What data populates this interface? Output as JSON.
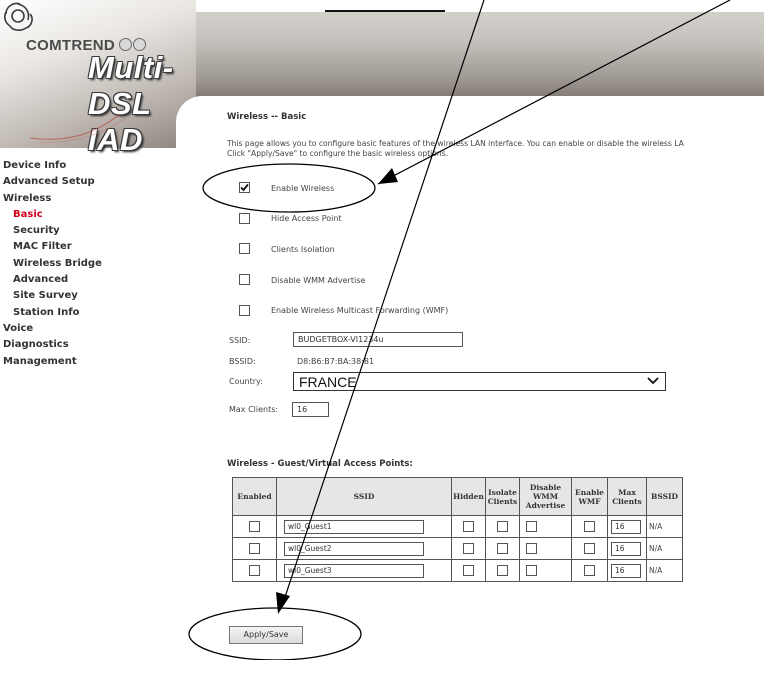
{
  "brand": {
    "company": "COMTREND",
    "product": "Multi-DSL IAD"
  },
  "sidebar": {
    "items": [
      {
        "label": "Device Info",
        "level": 0
      },
      {
        "label": "Advanced Setup",
        "level": 0
      },
      {
        "label": "Wireless",
        "level": 0
      },
      {
        "label": "Basic",
        "level": 1,
        "active": true
      },
      {
        "label": "Security",
        "level": 1
      },
      {
        "label": "MAC Filter",
        "level": 1
      },
      {
        "label": "Wireless Bridge",
        "level": 1
      },
      {
        "label": "Advanced",
        "level": 1
      },
      {
        "label": "Site Survey",
        "level": 1
      },
      {
        "label": "Station Info",
        "level": 1
      },
      {
        "label": "Voice",
        "level": 0
      },
      {
        "label": "Diagnostics",
        "level": 0
      },
      {
        "label": "Management",
        "level": 0
      }
    ]
  },
  "page": {
    "title": "Wireless -- Basic",
    "description_line1": "This page allows you to configure basic features of the wireless LAN interface. You can enable or disable the wireless LA",
    "description_line2": "Click \"Apply/Save\" to configure the basic wireless options."
  },
  "options": [
    {
      "label": "Enable Wireless",
      "checked": true
    },
    {
      "label": "Hide Access Point",
      "checked": false
    },
    {
      "label": "Clients Isolation",
      "checked": false
    },
    {
      "label": "Disable WMM Advertise",
      "checked": false
    },
    {
      "label": "Enable Wireless Multicast Forwarding (WMF)",
      "checked": false
    }
  ],
  "fields": {
    "ssid_label": "SSID:",
    "ssid_value": "BUDGETBOX-VI1234u",
    "bssid_label": "BSSID:",
    "bssid_value": "D8:B6:B7:BA:38:81",
    "country_label": "Country:",
    "country_value": "FRANCE",
    "max_clients_label": "Max Clients:",
    "max_clients_value": "16"
  },
  "guest": {
    "title": "Wireless - Guest/Virtual Access Points:",
    "headers": [
      "Enabled",
      "SSID",
      "Hidden",
      "Isolate Clients",
      "Disable WMM Advertise",
      "Enable WMF",
      "Max Clients",
      "BSSID"
    ],
    "rows": [
      {
        "ssid": "wl0_Guest1",
        "max_clients": "16",
        "bssid": "N/A"
      },
      {
        "ssid": "wl0_Guest2",
        "max_clients": "16",
        "bssid": "N/A"
      },
      {
        "ssid": "wl0_Guest3",
        "max_clients": "16",
        "bssid": "N/A"
      }
    ]
  },
  "actions": {
    "apply_label": "Apply/Save"
  },
  "colors": {
    "active_nav": "#d0021b",
    "header_gray": "#9e9791",
    "annotation": "#000000"
  }
}
